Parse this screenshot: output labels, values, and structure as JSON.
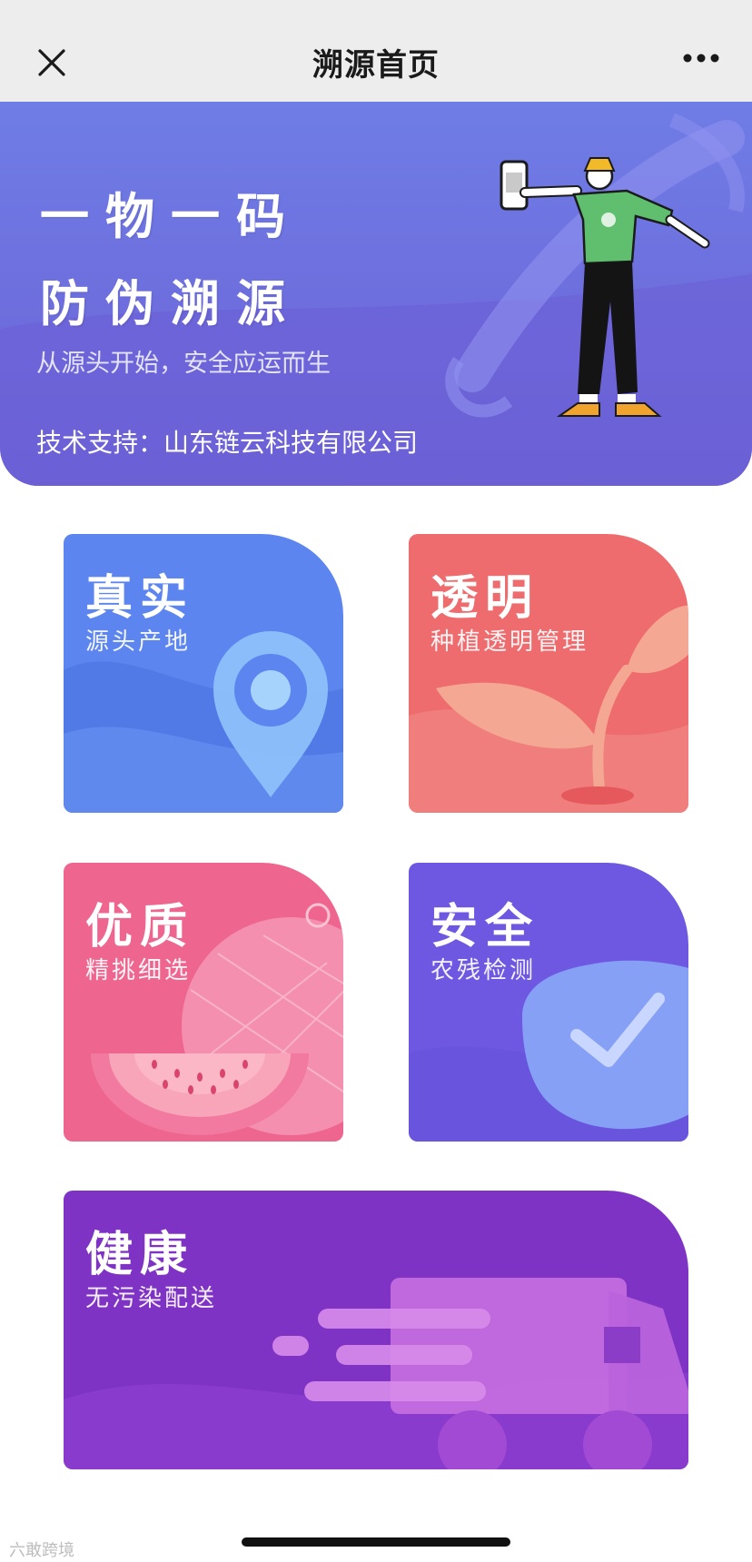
{
  "nav": {
    "title": "溯源首页",
    "close_icon": "close-icon",
    "more_icon": "more-icon"
  },
  "banner": {
    "line1": "一物一码",
    "line2": "防伪溯源",
    "slogan": "从源头开始，安全应运而生",
    "support": "技术支持：山东链云科技有限公司",
    "illustration": "person-holding-phone"
  },
  "cards": [
    {
      "title": "真实",
      "subtitle": "源头产地",
      "icon": "location-pin-icon",
      "color": "#5c85ef"
    },
    {
      "title": "透明",
      "subtitle": "种植透明管理",
      "icon": "sprout-icon",
      "color": "#ee6c6e"
    },
    {
      "title": "优质",
      "subtitle": "精挑细选",
      "icon": "melon-icon",
      "color": "#ee6690"
    },
    {
      "title": "安全",
      "subtitle": "农残检测",
      "icon": "shield-check-icon",
      "color": "#6e58e2"
    },
    {
      "title": "健康",
      "subtitle": "无污染配送",
      "icon": "delivery-truck-icon",
      "color": "#7e33c4"
    }
  ],
  "watermark": "六敢跨境"
}
